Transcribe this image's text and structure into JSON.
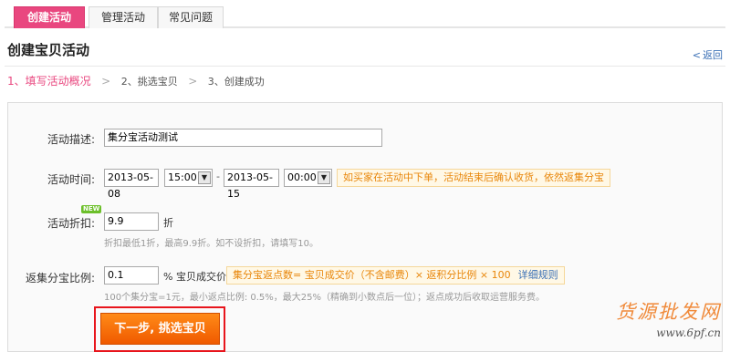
{
  "tabs": [
    {
      "label": "创建活动",
      "active": true
    },
    {
      "label": "管理活动",
      "active": false
    },
    {
      "label": "常见问题",
      "active": false
    }
  ],
  "page_title": "创建宝贝活动",
  "back_link": "返回",
  "steps": [
    {
      "label": "1、填写活动概况",
      "active": true
    },
    {
      "label": "2、挑选宝贝",
      "active": false
    },
    {
      "label": "3、创建成功",
      "active": false
    }
  ],
  "form": {
    "description": {
      "label": "活动描述:",
      "value": "集分宝活动测试"
    },
    "time": {
      "label": "活动时间:",
      "start_date": "2013-05-08",
      "start_time": "15:00",
      "separator": "-",
      "end_date": "2013-05-15",
      "end_time": "00:00",
      "note": "如买家在活动中下单，活动结束后确认收货，依然返集分宝"
    },
    "discount": {
      "label": "活动折扣:",
      "badge": "NEW",
      "value": "9.9",
      "unit": "折",
      "hint": "折扣最低1折，最高9.9折。如不设折扣，请填写10。"
    },
    "ratio": {
      "label": "返集分宝比例:",
      "value": "0.1",
      "unit": "% 宝贝成交价",
      "formula": "集分宝返点数= 宝贝成交价（不含邮费）× 返积分比例 × 100",
      "rule_link": "详细规则",
      "hint": "100个集分宝=1元，最小返点比例: 0.5%，最大25%（精确到小数点后一位）；返点成功后收取运营服务费。"
    }
  },
  "next_button": "下一步, 挑选宝贝",
  "watermark": {
    "text": "货源批发网",
    "url": "www.6pf.cn"
  },
  "colors": {
    "accent": "#e9477f",
    "button": "#f26a00",
    "highlight": "#e8151c"
  }
}
